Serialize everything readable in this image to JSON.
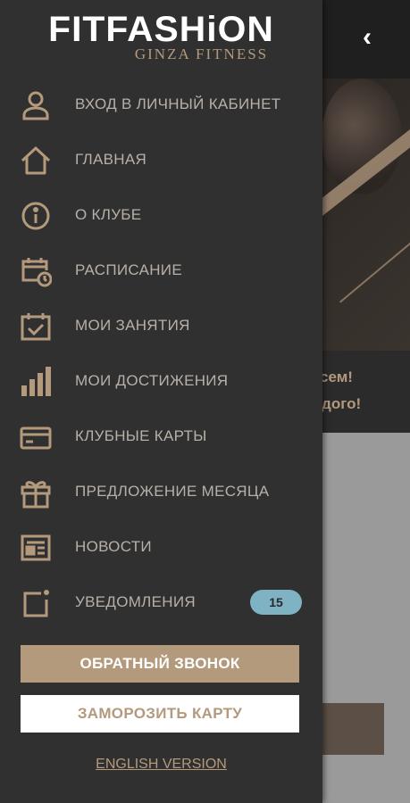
{
  "background": {
    "banner_line1": "всем!",
    "banner_line2": "ждого!"
  },
  "header": {
    "back_icon": "chevron-left-icon"
  },
  "logo": {
    "main": "FITFASHiON",
    "sub": "GINZA FITNESS"
  },
  "menu": {
    "items": [
      {
        "id": "login",
        "label": "ВХОД В ЛИЧНЫЙ КАБИНЕТ",
        "icon": "user-icon"
      },
      {
        "id": "home",
        "label": "ГЛАВНАЯ",
        "icon": "home-icon"
      },
      {
        "id": "about",
        "label": "О КЛУБЕ",
        "icon": "info-icon"
      },
      {
        "id": "schedule",
        "label": "РАСПИСАНИЕ",
        "icon": "calendar-clock-icon"
      },
      {
        "id": "my-classes",
        "label": "МОИ ЗАНЯТИЯ",
        "icon": "calendar-check-icon"
      },
      {
        "id": "achievements",
        "label": "МОИ ДОСТИЖЕНИЯ",
        "icon": "bar-chart-icon"
      },
      {
        "id": "club-cards",
        "label": "КЛУБНЫЕ КАРТЫ",
        "icon": "credit-card-icon"
      },
      {
        "id": "offer",
        "label": "ПРЕДЛОЖЕНИЕ МЕСЯЦА",
        "icon": "gift-icon"
      },
      {
        "id": "news",
        "label": "НОВОСТИ",
        "icon": "newspaper-icon"
      },
      {
        "id": "notifications",
        "label": "УВЕДОМЛЕНИЯ",
        "icon": "notification-icon",
        "badge": "15"
      }
    ]
  },
  "buttons": {
    "callback": "ОБРАТНЫЙ ЗВОНОК",
    "freeze": "ЗАМОРОЗИТЬ КАРТУ",
    "english": "ENGLISH VERSION"
  },
  "colors": {
    "drawer_bg": "#303030",
    "accent": "#b49a7c",
    "badge": "#7fb2c2",
    "text": "#b8b0a8"
  }
}
